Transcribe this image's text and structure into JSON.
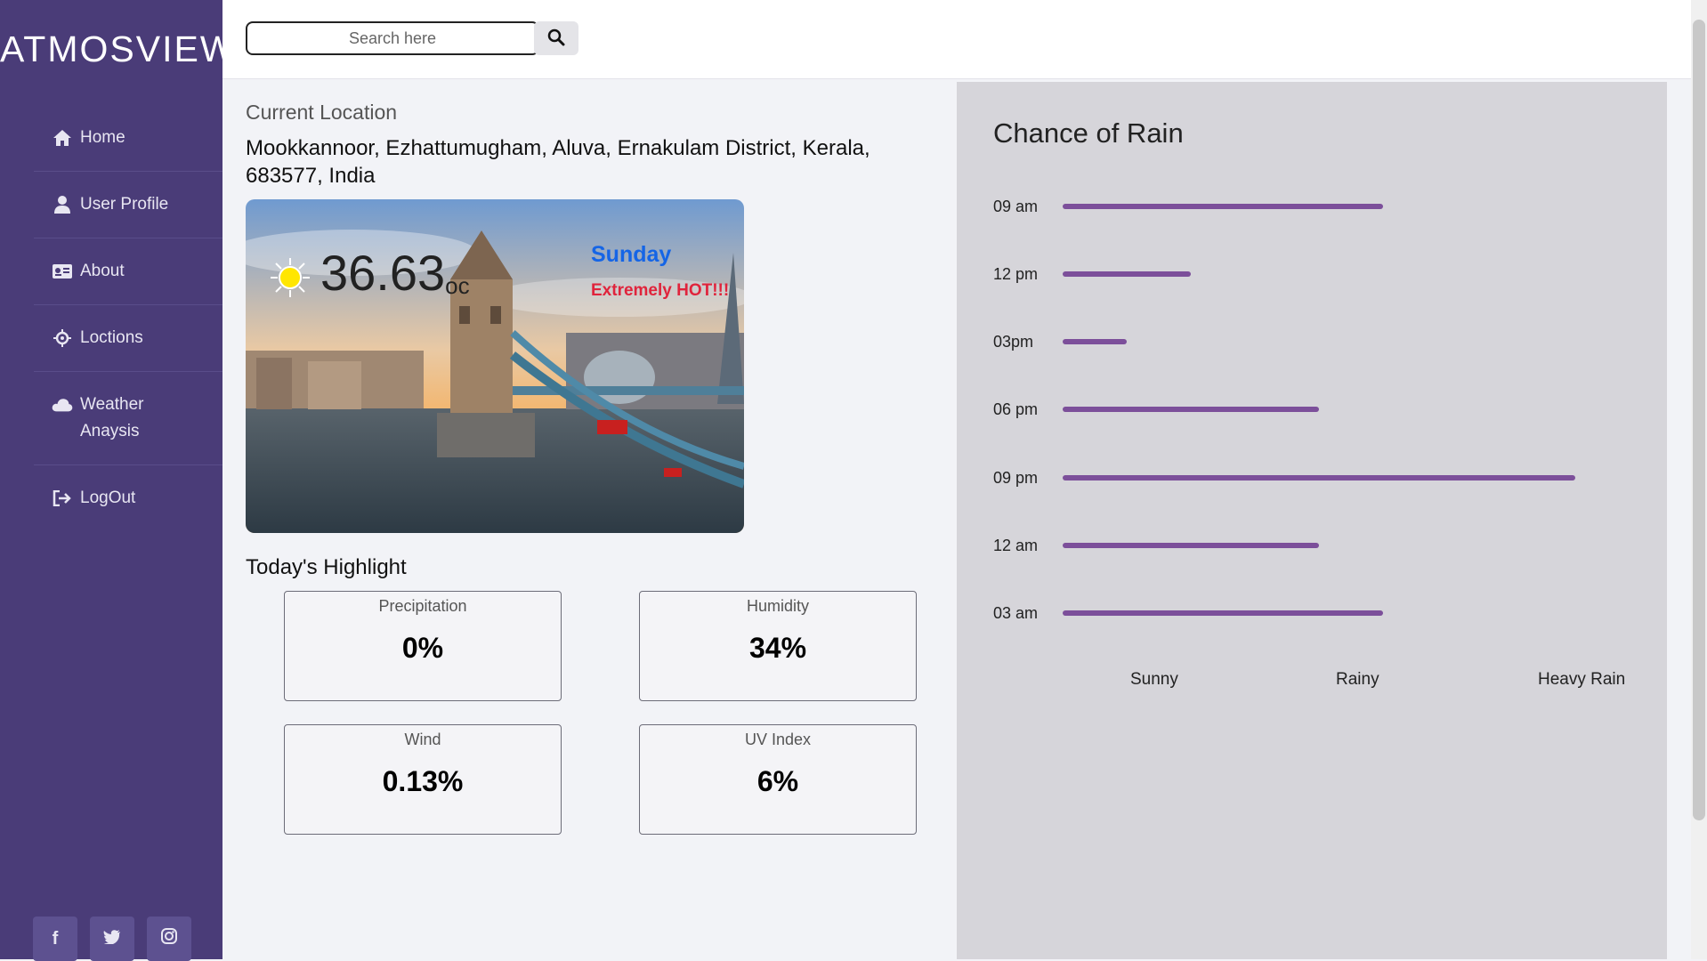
{
  "sidebar": {
    "brand": "ATMOSVIEW",
    "items": [
      {
        "label": "Home",
        "icon": "home-icon"
      },
      {
        "label": "User Profile",
        "icon": "user-icon"
      },
      {
        "label": "About",
        "icon": "id-card-icon"
      },
      {
        "label": "Loctions",
        "icon": "crosshair-icon"
      },
      {
        "label": "Weather Anaysis",
        "icon": "cloud-icon"
      },
      {
        "label": "LogOut",
        "icon": "logout-icon"
      }
    ],
    "socials": [
      {
        "glyph": "f",
        "icon": "facebook-icon"
      },
      {
        "glyph": "",
        "icon": "twitter-icon"
      },
      {
        "glyph": "",
        "icon": "instagram-icon"
      }
    ]
  },
  "search": {
    "placeholder": "Search here"
  },
  "location": {
    "title": "Current Location",
    "address": "Mookkannoor, Ezhattumugham, Aluva, Ernakulam District, Kerala, 683577, India"
  },
  "weather": {
    "temperature": "36.63",
    "unit": "oc",
    "day": "Sunday",
    "status": "Extremely HOT!!!"
  },
  "highlights": {
    "title": "Today's Highlight",
    "cards": [
      {
        "label": "Precipitation",
        "value": "0%"
      },
      {
        "label": "Humidity",
        "value": "34%"
      },
      {
        "label": "Wind",
        "value": "0.13%"
      },
      {
        "label": "UV Index",
        "value": "6%"
      }
    ]
  },
  "rain": {
    "title": "Chance of Rain",
    "rows": [
      {
        "time": "09 am",
        "level": 0.5
      },
      {
        "time": "12 pm",
        "level": 0.2
      },
      {
        "time": "03pm",
        "level": 0.1
      },
      {
        "time": "06 pm",
        "level": 0.4
      },
      {
        "time": "09 pm",
        "level": 0.8
      },
      {
        "time": "12 am",
        "level": 0.4
      },
      {
        "time": "03 am",
        "level": 0.5
      }
    ],
    "legend": [
      "Sunny",
      "Rainy",
      "Heavy Rain"
    ]
  },
  "colors": {
    "sidebar": "#4a3c78",
    "accent_bar": "#7c4f9a",
    "day": "#1565e6",
    "status": "#e0243c"
  }
}
